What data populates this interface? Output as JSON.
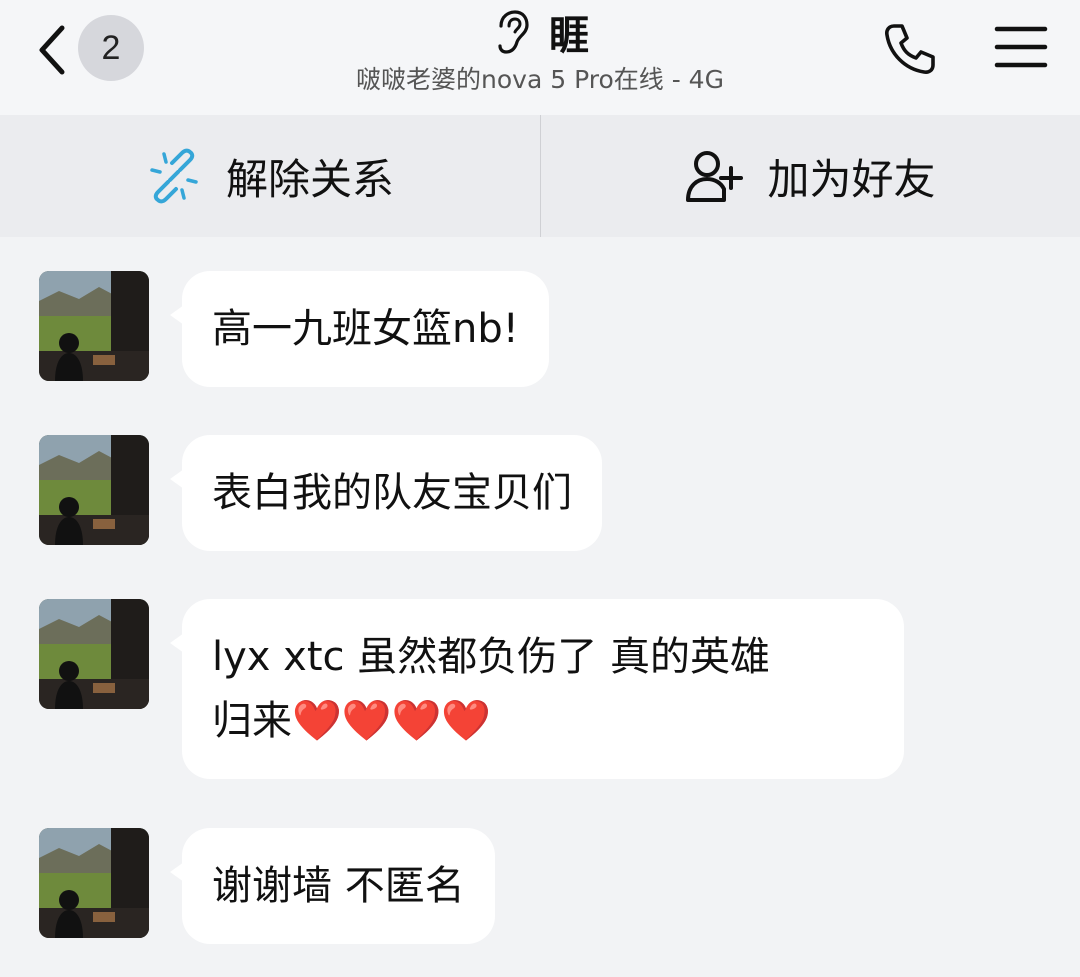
{
  "header": {
    "unread_count": "2",
    "title": "睚",
    "subtitle": "啵啵老婆的nova 5 Pro在线 - 4G"
  },
  "actions": {
    "unlink_label": "解除关系",
    "add_friend_label": "加为好友"
  },
  "messages": [
    {
      "text": "高一九班女篮nb!"
    },
    {
      "text": "表白我的队友宝贝们"
    },
    {
      "line1": "lyx xtc 虽然都负伤了 真的英雄",
      "line2": "归来",
      "hearts": "❤️❤️❤️❤️"
    },
    {
      "text": "谢谢墙 不匿名"
    }
  ],
  "colors": {
    "background": "#f2f3f5",
    "action_bar": "#ebecef",
    "bubble": "#ffffff",
    "link_icon": "#35a6d8"
  },
  "icons": [
    "back-chevron-icon",
    "ear-icon",
    "phone-icon",
    "menu-icon",
    "unlink-icon",
    "add-user-icon"
  ]
}
